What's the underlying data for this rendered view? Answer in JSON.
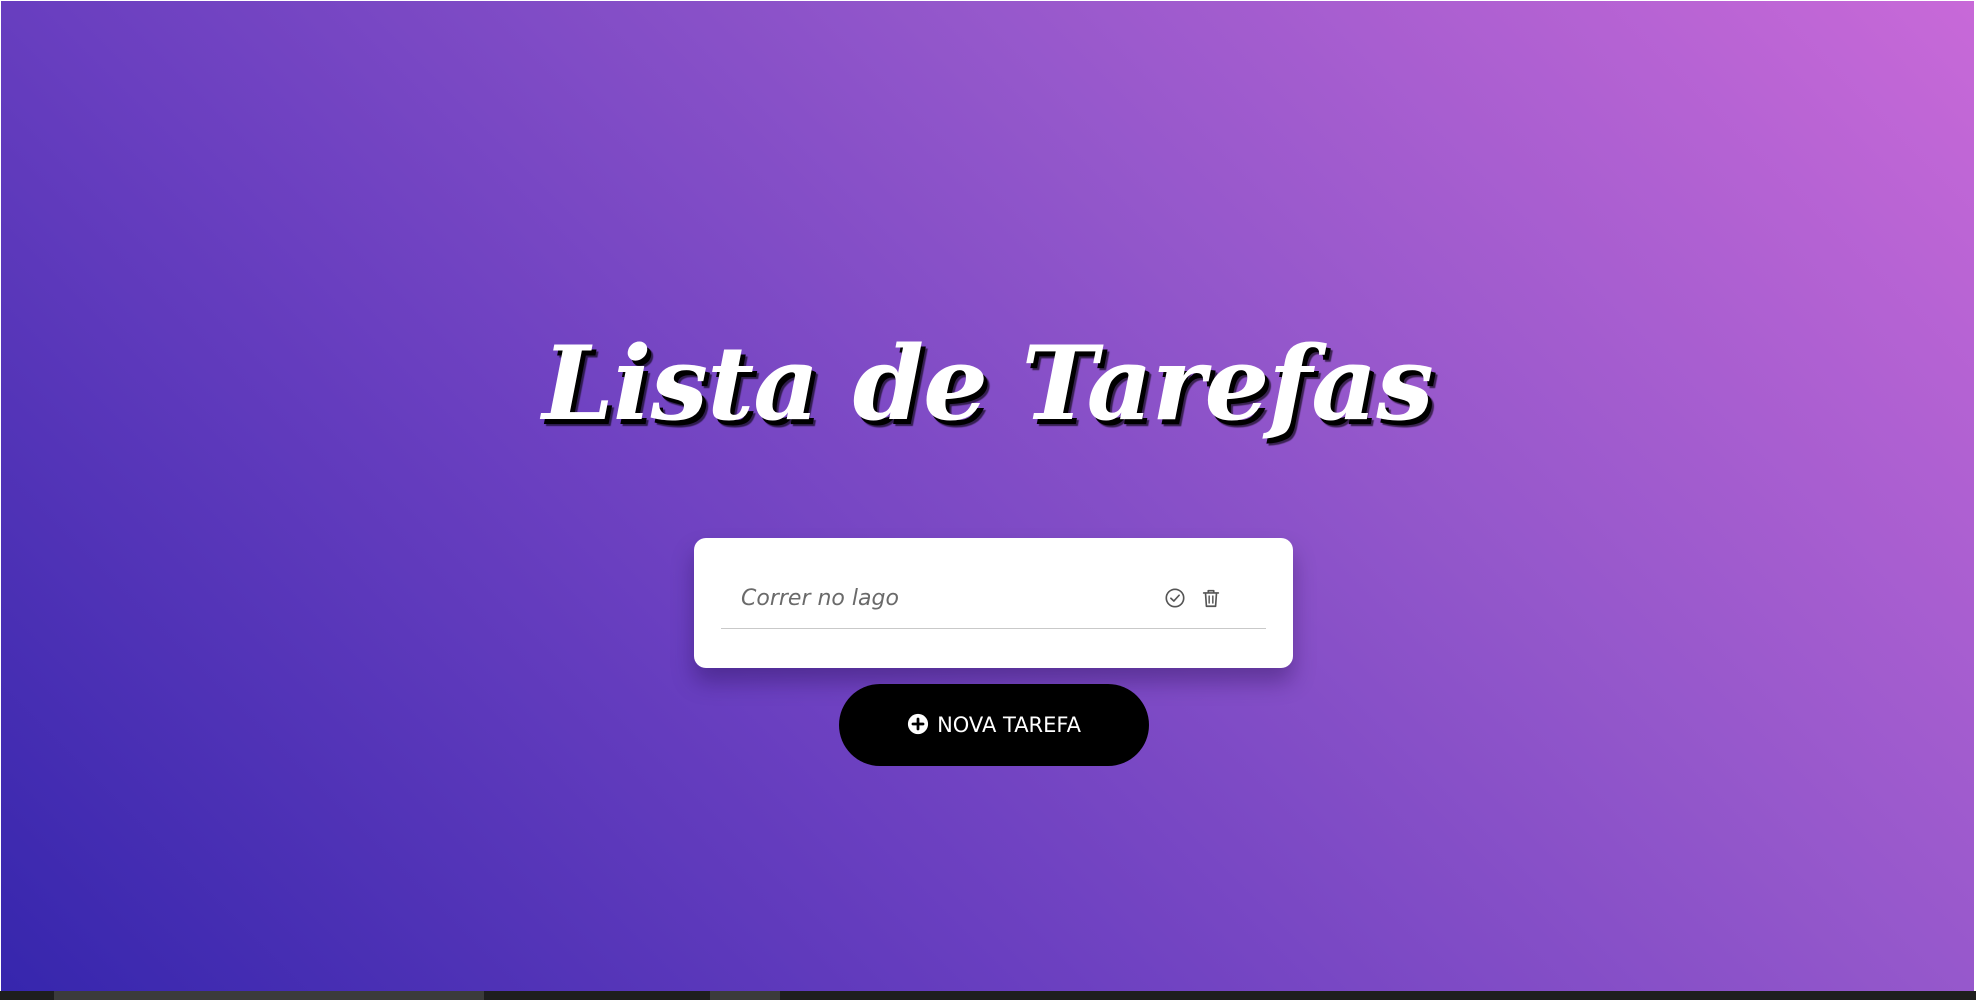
{
  "page": {
    "title": "Lista de Tarefas"
  },
  "tasks": [
    {
      "text": "Correr no lago",
      "complete_icon": "check-circle-icon",
      "delete_icon": "trash-icon"
    }
  ],
  "actions": {
    "new_task_label": "NOVA TAREFA",
    "new_task_icon": "plus-circle-icon"
  },
  "colors": {
    "gradient_start": "#3626ad",
    "gradient_end": "#c869d8",
    "card_background": "#ffffff",
    "button_background": "#000000",
    "button_text": "#ffffff"
  }
}
